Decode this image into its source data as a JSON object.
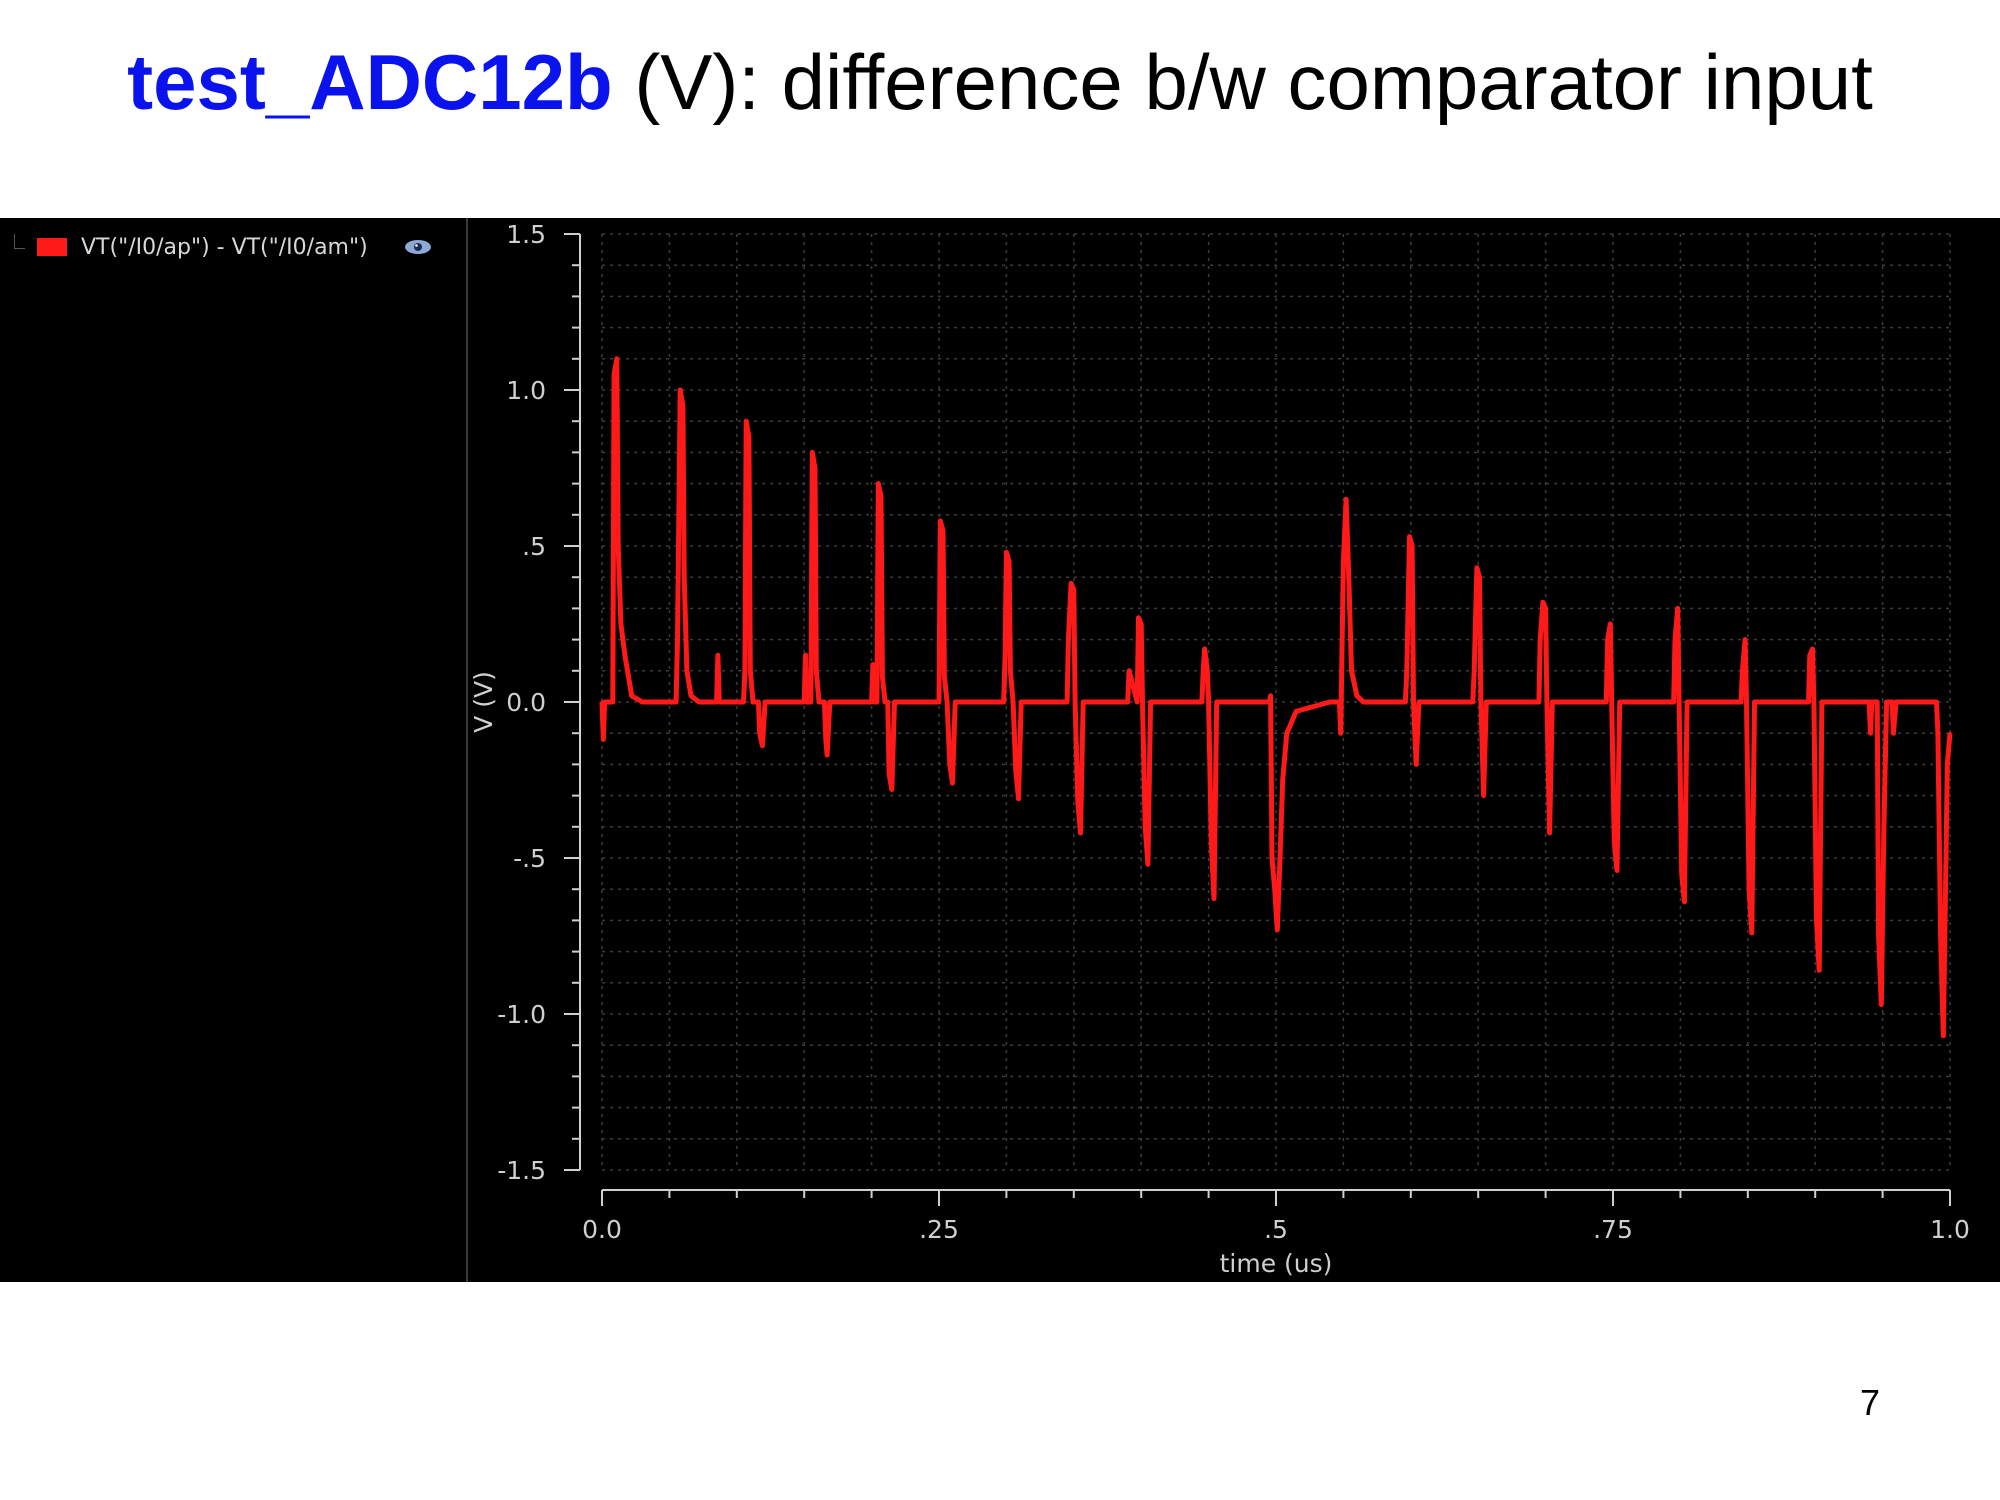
{
  "slide": {
    "title_strong": "test_ADC12b",
    "title_rest": " (V): difference b/w comparator input",
    "page_number": "7"
  },
  "legend": {
    "label": "VT(\"/I0/ap\") - VT(\"/I0/am\")",
    "swatch_color": "#ff1a1a",
    "visibility_icon": "eye-icon"
  },
  "colors": {
    "background": "#000000",
    "grid": "#3c3c3c",
    "axis": "#cfcfcf",
    "trace": "#ff1a1a",
    "title_accent": "#0a12ee"
  },
  "chart_data": {
    "type": "line",
    "xlabel": "time (us)",
    "ylabel": "V (V)",
    "xlim": [
      0.0,
      1.0
    ],
    "ylim": [
      -1.5,
      1.5
    ],
    "x_ticks": [
      {
        "value": 0.0,
        "label": "0.0"
      },
      {
        "value": 0.25,
        "label": ".25"
      },
      {
        "value": 0.5,
        "label": ".5"
      },
      {
        "value": 0.75,
        "label": ".75"
      },
      {
        "value": 1.0,
        "label": "1.0"
      }
    ],
    "y_ticks": [
      {
        "value": 1.5,
        "label": "1.5"
      },
      {
        "value": 1.0,
        "label": "1.0"
      },
      {
        "value": 0.5,
        "label": ".5"
      },
      {
        "value": 0.0,
        "label": "0.0"
      },
      {
        "value": -0.5,
        "label": "-.5"
      },
      {
        "value": -1.0,
        "label": "-1.0"
      },
      {
        "value": -1.5,
        "label": "-1.5"
      }
    ],
    "grid": true,
    "series": [
      {
        "name": "VT(\"/I0/ap\") - VT(\"/I0/am\")",
        "color": "#ff1a1a",
        "points": [
          [
            0.0,
            0.0
          ],
          [
            0.001,
            -0.12
          ],
          [
            0.002,
            0.0
          ],
          [
            0.008,
            0.0
          ],
          [
            0.009,
            1.05
          ],
          [
            0.011,
            1.1
          ],
          [
            0.012,
            0.5
          ],
          [
            0.014,
            0.25
          ],
          [
            0.017,
            0.15
          ],
          [
            0.022,
            0.02
          ],
          [
            0.03,
            0.0
          ],
          [
            0.055,
            0.0
          ],
          [
            0.056,
            0.2
          ],
          [
            0.058,
            1.0
          ],
          [
            0.06,
            0.95
          ],
          [
            0.061,
            0.4
          ],
          [
            0.063,
            0.1
          ],
          [
            0.066,
            0.02
          ],
          [
            0.072,
            0.0
          ],
          [
            0.085,
            0.0
          ],
          [
            0.086,
            0.15
          ],
          [
            0.087,
            0.0
          ],
          [
            0.105,
            0.0
          ],
          [
            0.106,
            0.1
          ],
          [
            0.107,
            0.9
          ],
          [
            0.109,
            0.85
          ],
          [
            0.11,
            0.1
          ],
          [
            0.112,
            0.0
          ],
          [
            0.116,
            0.0
          ],
          [
            0.117,
            -0.1
          ],
          [
            0.119,
            -0.14
          ],
          [
            0.121,
            0.0
          ],
          [
            0.15,
            0.0
          ],
          [
            0.151,
            0.15
          ],
          [
            0.152,
            0.0
          ],
          [
            0.155,
            0.0
          ],
          [
            0.156,
            0.8
          ],
          [
            0.158,
            0.75
          ],
          [
            0.159,
            0.1
          ],
          [
            0.161,
            0.0
          ],
          [
            0.165,
            0.0
          ],
          [
            0.166,
            -0.12
          ],
          [
            0.167,
            -0.17
          ],
          [
            0.169,
            0.0
          ],
          [
            0.2,
            0.0
          ],
          [
            0.201,
            0.12
          ],
          [
            0.202,
            0.0
          ],
          [
            0.204,
            0.0
          ],
          [
            0.205,
            0.7
          ],
          [
            0.207,
            0.66
          ],
          [
            0.208,
            0.08
          ],
          [
            0.21,
            0.0
          ],
          [
            0.212,
            0.0
          ],
          [
            0.213,
            -0.23
          ],
          [
            0.215,
            -0.28
          ],
          [
            0.217,
            0.0
          ],
          [
            0.25,
            0.0
          ],
          [
            0.251,
            0.58
          ],
          [
            0.253,
            0.55
          ],
          [
            0.254,
            0.08
          ],
          [
            0.256,
            0.0
          ],
          [
            0.258,
            -0.2
          ],
          [
            0.26,
            -0.26
          ],
          [
            0.262,
            0.0
          ],
          [
            0.298,
            0.0
          ],
          [
            0.299,
            0.15
          ],
          [
            0.3,
            0.48
          ],
          [
            0.302,
            0.45
          ],
          [
            0.303,
            0.1
          ],
          [
            0.305,
            0.0
          ],
          [
            0.307,
            -0.22
          ],
          [
            0.309,
            -0.31
          ],
          [
            0.311,
            0.0
          ],
          [
            0.345,
            0.0
          ],
          [
            0.346,
            0.2
          ],
          [
            0.348,
            0.38
          ],
          [
            0.35,
            0.36
          ],
          [
            0.351,
            0.0
          ],
          [
            0.353,
            -0.32
          ],
          [
            0.355,
            -0.42
          ],
          [
            0.357,
            0.0
          ],
          [
            0.39,
            0.0
          ],
          [
            0.391,
            0.1
          ],
          [
            0.397,
            0.0
          ],
          [
            0.398,
            0.27
          ],
          [
            0.4,
            0.25
          ],
          [
            0.401,
            0.0
          ],
          [
            0.403,
            -0.4
          ],
          [
            0.405,
            -0.52
          ],
          [
            0.407,
            0.0
          ],
          [
            0.445,
            0.0
          ],
          [
            0.446,
            0.1
          ],
          [
            0.447,
            0.17
          ],
          [
            0.449,
            0.1
          ],
          [
            0.45,
            0.0
          ],
          [
            0.452,
            -0.45
          ],
          [
            0.454,
            -0.63
          ],
          [
            0.456,
            0.0
          ],
          [
            0.495,
            0.0
          ],
          [
            0.496,
            0.02
          ],
          [
            0.497,
            -0.5
          ],
          [
            0.499,
            -0.6
          ],
          [
            0.501,
            -0.73
          ],
          [
            0.503,
            -0.5
          ],
          [
            0.505,
            -0.25
          ],
          [
            0.508,
            -0.1
          ],
          [
            0.515,
            -0.03
          ],
          [
            0.54,
            0.0
          ],
          [
            0.547,
            0.0
          ],
          [
            0.548,
            -0.1
          ],
          [
            0.55,
            0.45
          ],
          [
            0.552,
            0.65
          ],
          [
            0.554,
            0.4
          ],
          [
            0.556,
            0.1
          ],
          [
            0.56,
            0.02
          ],
          [
            0.565,
            0.0
          ],
          [
            0.596,
            0.0
          ],
          [
            0.597,
            0.1
          ],
          [
            0.599,
            0.53
          ],
          [
            0.601,
            0.5
          ],
          [
            0.602,
            0.0
          ],
          [
            0.604,
            -0.2
          ],
          [
            0.606,
            0.0
          ],
          [
            0.646,
            0.0
          ],
          [
            0.647,
            0.1
          ],
          [
            0.649,
            0.43
          ],
          [
            0.651,
            0.4
          ],
          [
            0.652,
            0.0
          ],
          [
            0.654,
            -0.3
          ],
          [
            0.656,
            0.0
          ],
          [
            0.695,
            0.0
          ],
          [
            0.696,
            0.2
          ],
          [
            0.698,
            0.32
          ],
          [
            0.7,
            0.3
          ],
          [
            0.701,
            0.0
          ],
          [
            0.703,
            -0.42
          ],
          [
            0.705,
            0.0
          ],
          [
            0.745,
            0.0
          ],
          [
            0.746,
            0.2
          ],
          [
            0.748,
            0.25
          ],
          [
            0.749,
            0.0
          ],
          [
            0.751,
            -0.45
          ],
          [
            0.753,
            -0.54
          ],
          [
            0.755,
            0.0
          ],
          [
            0.795,
            0.0
          ],
          [
            0.796,
            0.2
          ],
          [
            0.798,
            0.3
          ],
          [
            0.799,
            0.0
          ],
          [
            0.801,
            -0.55
          ],
          [
            0.803,
            -0.64
          ],
          [
            0.805,
            0.0
          ],
          [
            0.845,
            0.0
          ],
          [
            0.846,
            0.1
          ],
          [
            0.848,
            0.2
          ],
          [
            0.849,
            0.0
          ],
          [
            0.851,
            -0.6
          ],
          [
            0.853,
            -0.74
          ],
          [
            0.855,
            0.0
          ],
          [
            0.895,
            0.0
          ],
          [
            0.896,
            0.15
          ],
          [
            0.898,
            0.17
          ],
          [
            0.899,
            0.0
          ],
          [
            0.901,
            -0.7
          ],
          [
            0.903,
            -0.86
          ],
          [
            0.905,
            0.0
          ],
          [
            0.94,
            0.0
          ],
          [
            0.941,
            -0.1
          ],
          [
            0.942,
            0.0
          ],
          [
            0.946,
            0.0
          ],
          [
            0.947,
            -0.75
          ],
          [
            0.949,
            -0.97
          ],
          [
            0.951,
            -0.4
          ],
          [
            0.953,
            0.0
          ],
          [
            0.957,
            0.0
          ],
          [
            0.958,
            -0.1
          ],
          [
            0.96,
            0.0
          ],
          [
            0.99,
            0.0
          ],
          [
            0.991,
            -0.1
          ],
          [
            0.993,
            -0.75
          ],
          [
            0.995,
            -1.07
          ],
          [
            0.997,
            -0.5
          ],
          [
            0.998,
            -0.2
          ],
          [
            1.0,
            -0.1
          ]
        ]
      }
    ]
  }
}
